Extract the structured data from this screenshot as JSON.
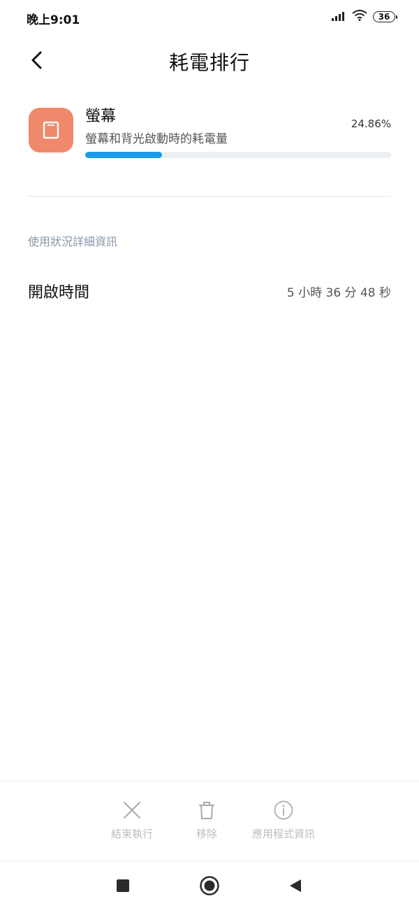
{
  "status_bar": {
    "time": "晚上9:01",
    "battery": "36"
  },
  "header": {
    "title": "耗電排行"
  },
  "item": {
    "title": "螢幕",
    "subtitle": "螢幕和背光啟動時的耗電量",
    "percent": "24.86%",
    "progress_fraction": 0.25,
    "icon": "screen-icon",
    "icon_color": "#f0886b"
  },
  "section": {
    "title": "使用狀況詳細資訊"
  },
  "detail": {
    "label": "開啟時間",
    "value": "5 小時 36 分 48 秒"
  },
  "actions": [
    {
      "label": "結束執行",
      "icon": "close-icon"
    },
    {
      "label": "移除",
      "icon": "trash-icon"
    },
    {
      "label": "應用程式資訊",
      "icon": "info-icon"
    }
  ],
  "nav": {
    "recents_icon": "square-icon",
    "home_icon": "circle-icon",
    "back_icon": "triangle-back-icon"
  },
  "colors": {
    "accent": "#1a9be8",
    "section_title": "#8a96a8"
  }
}
